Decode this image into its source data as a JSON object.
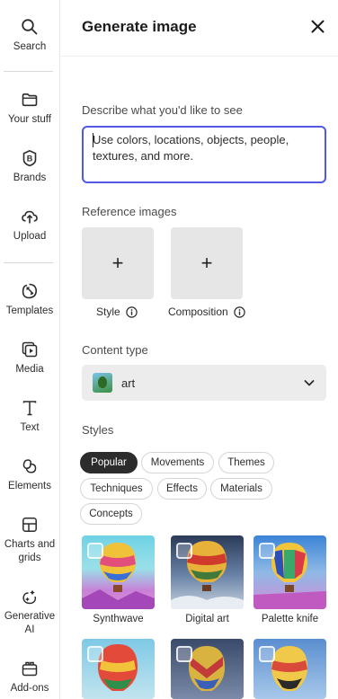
{
  "rail": {
    "items": [
      {
        "label": "Search",
        "icon": "search-icon"
      },
      {
        "label": "Your stuff",
        "icon": "folder-icon"
      },
      {
        "label": "Brands",
        "icon": "brand-icon"
      },
      {
        "label": "Upload",
        "icon": "upload-icon"
      },
      {
        "label": "Templates",
        "icon": "templates-icon"
      },
      {
        "label": "Media",
        "icon": "media-icon"
      },
      {
        "label": "Text",
        "icon": "text-icon"
      },
      {
        "label": "Elements",
        "icon": "elements-icon"
      },
      {
        "label": "Charts and\ngrids",
        "icon": "charts-icon"
      },
      {
        "label": "Generative\nAI",
        "icon": "generative-ai-icon"
      },
      {
        "label": "Add-ons",
        "icon": "add-ons-icon"
      }
    ]
  },
  "panel": {
    "title": "Generate image",
    "prompt_label": "Describe what you'd like to see",
    "prompt_placeholder": "Use colors, locations, objects, people, textures, and more.",
    "reference_label": "Reference images",
    "reference_items": [
      {
        "caption": "Style"
      },
      {
        "caption": "Composition"
      }
    ],
    "content_type_label": "Content type",
    "content_type_value": "art",
    "styles_label": "Styles",
    "style_chips": [
      {
        "label": "Popular",
        "active": true
      },
      {
        "label": "Movements",
        "active": false
      },
      {
        "label": "Themes",
        "active": false
      },
      {
        "label": "Techniques",
        "active": false
      },
      {
        "label": "Effects",
        "active": false
      },
      {
        "label": "Materials",
        "active": false
      },
      {
        "label": "Concepts",
        "active": false
      }
    ],
    "style_tiles": [
      {
        "caption": "Synthwave"
      },
      {
        "caption": "Digital art"
      },
      {
        "caption": "Palette knife"
      },
      {
        "caption": ""
      },
      {
        "caption": ""
      },
      {
        "caption": ""
      }
    ]
  },
  "colors": {
    "accent": "#5258e4",
    "chip_active": "#2c2c2c",
    "tile_bg": "#e6e6e6"
  }
}
